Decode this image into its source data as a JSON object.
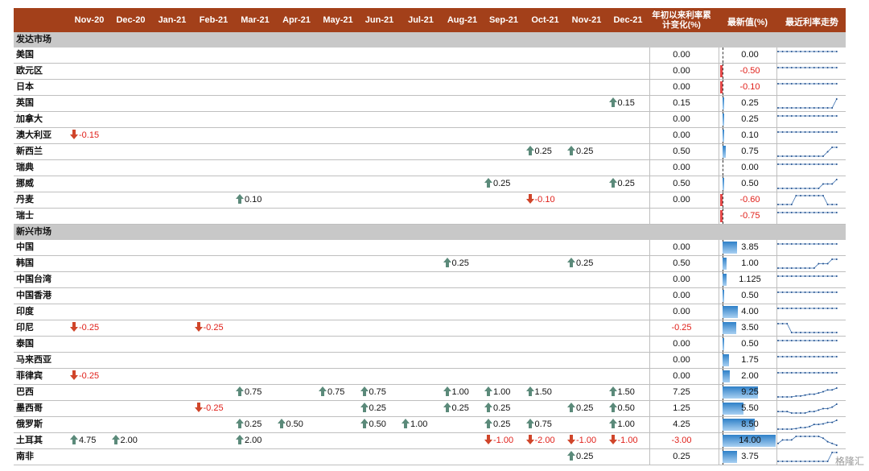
{
  "header": {
    "months": [
      "Nov-20",
      "Dec-20",
      "Jan-21",
      "Feb-21",
      "Mar-21",
      "Apr-21",
      "May-21",
      "Jun-21",
      "Jul-21",
      "Aug-21",
      "Sep-21",
      "Oct-21",
      "Nov-21",
      "Dec-21"
    ],
    "ytd_label": "年初以来利率累计变化(%)",
    "latest_label": "最新值(%)",
    "trend_label": "最近利率走势"
  },
  "colors": {
    "header_bg": "#a3401a",
    "section_bg": "#c8c8c8",
    "up": "#5b8a7a",
    "down": "#d0452a",
    "neg_text": "#e0201a",
    "bar": "#2f80c8"
  },
  "sections": [
    {
      "title": "发达市场",
      "rows": [
        {
          "name": "美国",
          "changes": {},
          "ytd": "0.00",
          "latest": "0.00"
        },
        {
          "name": "欧元区",
          "changes": {},
          "ytd": "0.00",
          "latest": "-0.50"
        },
        {
          "name": "日本",
          "changes": {},
          "ytd": "0.00",
          "latest": "-0.10"
        },
        {
          "name": "英国",
          "changes": {
            "13": "0.15"
          },
          "ytd": "0.15",
          "latest": "0.25"
        },
        {
          "name": "加拿大",
          "changes": {},
          "ytd": "0.00",
          "latest": "0.25"
        },
        {
          "name": "澳大利亚",
          "changes": {
            "0": "-0.15"
          },
          "ytd": "0.00",
          "latest": "0.10"
        },
        {
          "name": "新西兰",
          "changes": {
            "11": "0.25",
            "12": "0.25"
          },
          "ytd": "0.50",
          "latest": "0.75"
        },
        {
          "name": "瑞典",
          "changes": {},
          "ytd": "0.00",
          "latest": "0.00"
        },
        {
          "name": "挪威",
          "changes": {
            "10": "0.25",
            "13": "0.25"
          },
          "ytd": "0.50",
          "latest": "0.50"
        },
        {
          "name": "丹麦",
          "changes": {
            "4": "0.10",
            "11": "-0.10"
          },
          "ytd": "0.00",
          "latest": "-0.60"
        },
        {
          "name": "瑞士",
          "changes": {},
          "ytd": "",
          "latest": "-0.75"
        }
      ]
    },
    {
      "title": "新兴市场",
      "rows": [
        {
          "name": "中国",
          "changes": {},
          "ytd": "0.00",
          "latest": "3.85"
        },
        {
          "name": "韩国",
          "changes": {
            "9": "0.25",
            "12": "0.25"
          },
          "ytd": "0.50",
          "latest": "1.00"
        },
        {
          "name": "中国台湾",
          "changes": {},
          "ytd": "0.00",
          "latest": "1.125"
        },
        {
          "name": "中国香港",
          "changes": {},
          "ytd": "0.00",
          "latest": "0.50"
        },
        {
          "name": "印度",
          "changes": {},
          "ytd": "0.00",
          "latest": "4.00"
        },
        {
          "name": "印尼",
          "changes": {
            "0": "-0.25",
            "3": "-0.25"
          },
          "ytd": "-0.25",
          "latest": "3.50"
        },
        {
          "name": "泰国",
          "changes": {},
          "ytd": "0.00",
          "latest": "0.50"
        },
        {
          "name": "马来西亚",
          "changes": {},
          "ytd": "0.00",
          "latest": "1.75"
        },
        {
          "name": "菲律宾",
          "changes": {
            "0": "-0.25"
          },
          "ytd": "0.00",
          "latest": "2.00"
        },
        {
          "name": "巴西",
          "changes": {
            "4": "0.75",
            "6": "0.75",
            "7": "0.75",
            "9": "1.00",
            "10": "1.00",
            "11": "1.50",
            "13": "1.50"
          },
          "ytd": "7.25",
          "latest": "9.25"
        },
        {
          "name": "墨西哥",
          "changes": {
            "3": "-0.25",
            "7": "0.25",
            "9": "0.25",
            "10": "0.25",
            "12": "0.25",
            "13": "0.50"
          },
          "ytd": "1.25",
          "latest": "5.50"
        },
        {
          "name": "俄罗斯",
          "changes": {
            "4": "0.25",
            "5": "0.50",
            "7": "0.50",
            "8": "1.00",
            "10": "0.25",
            "11": "0.75",
            "13": "1.00"
          },
          "ytd": "4.25",
          "latest": "8.50"
        },
        {
          "name": "土耳其",
          "changes": {
            "0": "4.75",
            "1": "2.00",
            "4": "2.00",
            "10": "-1.00",
            "11": "-2.00",
            "12": "-1.00",
            "13": "-1.00"
          },
          "ytd": "-3.00",
          "latest": "14.00"
        },
        {
          "name": "南非",
          "changes": {
            "12": "0.25"
          },
          "ytd": "0.25",
          "latest": "3.75"
        }
      ]
    }
  ],
  "watermark": "格隆汇"
}
